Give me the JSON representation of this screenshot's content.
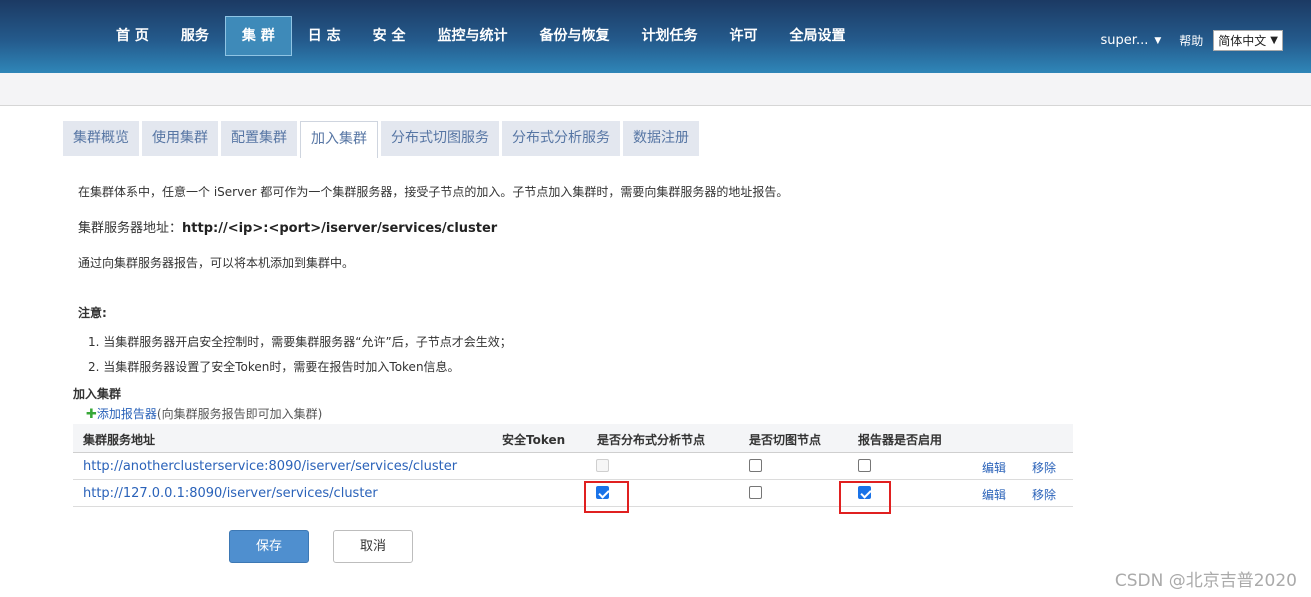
{
  "nav": {
    "items": [
      "首 页",
      "服务",
      "集 群",
      "日 志",
      "安 全",
      "监控与统计",
      "备份与恢复",
      "计划任务",
      "许可",
      "全局设置"
    ],
    "active_index": 2,
    "user": "super...",
    "help": "帮助",
    "language": "简体中文"
  },
  "tabs": {
    "items": [
      "集群概览",
      "使用集群",
      "配置集群",
      "加入集群",
      "分布式切图服务",
      "分布式分析服务",
      "数据注册"
    ],
    "active_index": 3
  },
  "intro": {
    "line1": "在集群体系中，任意一个 iServer 都可作为一个集群服务器，接受子节点的加入。子节点加入集群时，需要向集群服务器的地址报告。",
    "address_label": "集群服务器地址：",
    "address_value": "http://<ip>:<port>/iserver/services/cluster",
    "line3": "通过向集群服务器报告，可以将本机添加到集群中。"
  },
  "note": {
    "title": "注意:",
    "items": [
      "1. 当集群服务器开启安全控制时，需要集群服务器“允许”后，子节点才会生效；",
      "2. 当集群服务器设置了安全Token时，需要在报告时加入Token信息。"
    ]
  },
  "join": {
    "title": "加入集群",
    "add_link": "添加报告器",
    "add_hint": "(向集群服务报告即可加入集群)"
  },
  "table": {
    "headers": {
      "address": "集群服务地址",
      "token": "安全Token",
      "distributed_analysis": "是否分布式分析节点",
      "tile_node": "是否切图节点",
      "enabled": "报告器是否启用"
    },
    "rows": [
      {
        "address": "http://anotherclusterservice:8090/iserver/services/cluster",
        "token": "",
        "distributed_analysis": false,
        "distributed_analysis_disabled": true,
        "tile_node": false,
        "enabled": false,
        "edit": "编辑",
        "remove": "移除"
      },
      {
        "address": "http://127.0.0.1:8090/iserver/services/cluster",
        "token": "",
        "distributed_analysis": true,
        "distributed_analysis_disabled": false,
        "tile_node": false,
        "enabled": true,
        "edit": "编辑",
        "remove": "移除"
      }
    ]
  },
  "buttons": {
    "save": "保存",
    "cancel": "取消"
  },
  "watermark": "CSDN @北京吉普2020",
  "colors": {
    "header_dark": "#1c3a63",
    "header_light": "#2f86b8",
    "link": "#2a62b9",
    "highlight": "#e02020",
    "save_button": "#4f8fcf"
  }
}
